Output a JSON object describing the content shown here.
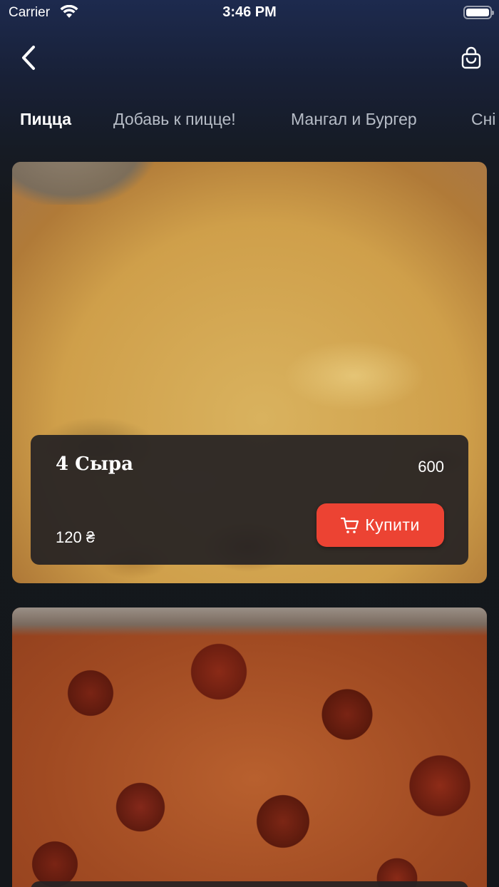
{
  "status_bar": {
    "carrier": "Carrier",
    "time": "3:46 PM"
  },
  "nav": {
    "back_icon": "chevron-left-icon",
    "cart_icon": "shopping-bag-icon"
  },
  "tabs": [
    {
      "label": "Пицца",
      "active": true
    },
    {
      "label": "Добавь к пицце!",
      "active": false
    },
    {
      "label": "Мангал и Бургер",
      "active": false
    },
    {
      "label": "Сні",
      "active": false
    }
  ],
  "products": [
    {
      "name": "4 Сыра",
      "weight": "600",
      "price": "120 ₴",
      "buy_label": "Купити",
      "buy_icon": "cart-icon"
    },
    {
      "name": "",
      "weight": "",
      "price": "",
      "buy_label": ""
    }
  ],
  "colors": {
    "accent": "#ec4333",
    "panel": "#262224",
    "background": "#15181c",
    "header_top": "#1d2a4e"
  }
}
